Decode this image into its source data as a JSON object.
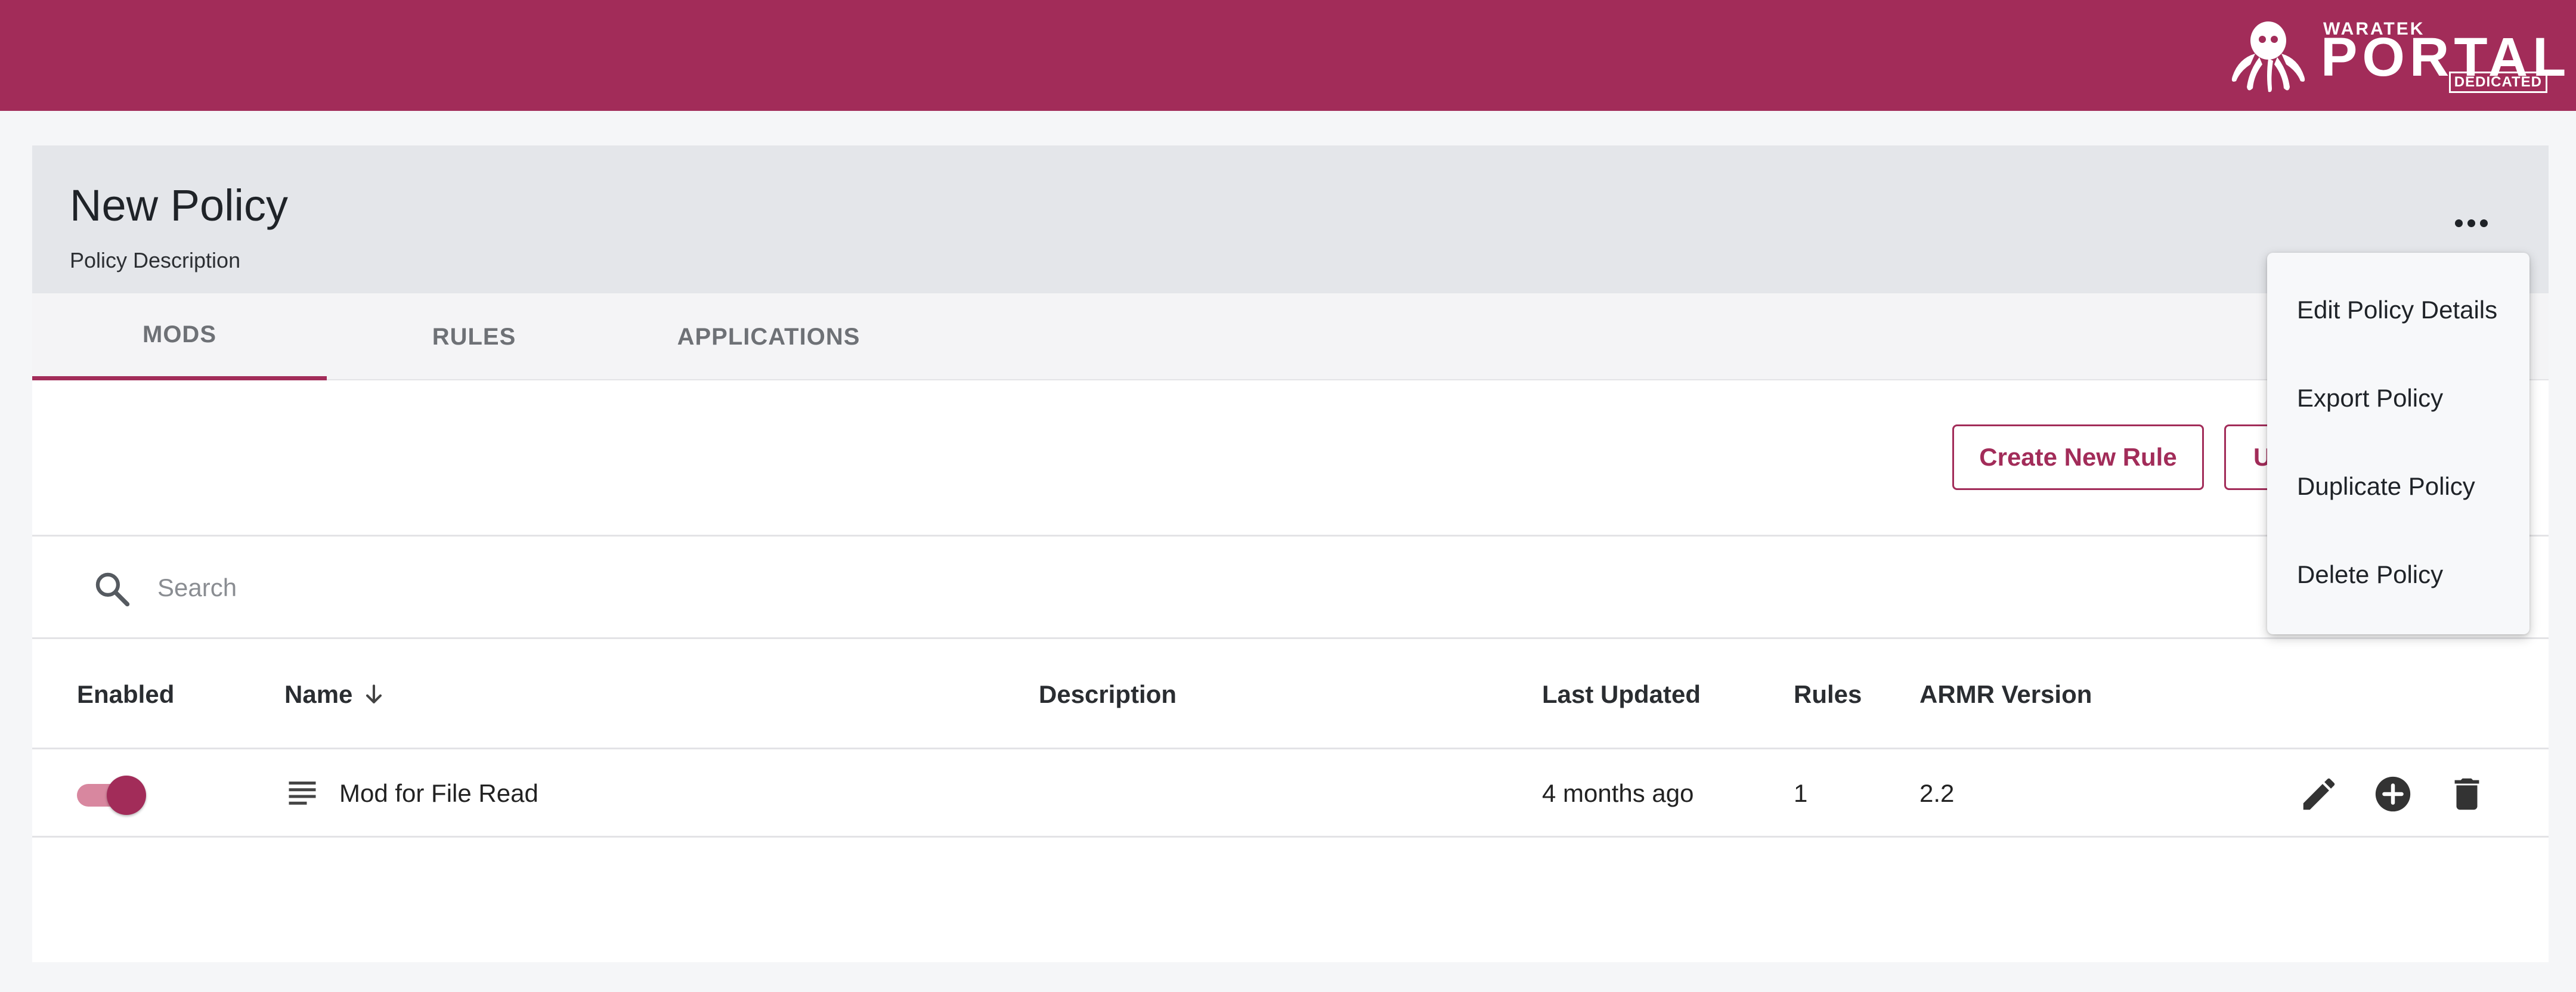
{
  "brand": {
    "small": "WARATEK",
    "big": "PORTAL",
    "badge": "DEDICATED",
    "primary_color": "#a22c59"
  },
  "policy": {
    "title": "New Policy",
    "description": "Policy Description"
  },
  "tabs": [
    {
      "label": "MODS",
      "active": true
    },
    {
      "label": "RULES",
      "active": false
    },
    {
      "label": "APPLICATIONS",
      "active": false
    }
  ],
  "toolbar": {
    "create_label": "Create New Rule",
    "second_label": "U"
  },
  "search": {
    "placeholder": "Search"
  },
  "table": {
    "columns": [
      "Enabled",
      "Name",
      "Description",
      "Last Updated",
      "Rules",
      "ARMR Version"
    ],
    "sort_column": "Name",
    "rows": [
      {
        "enabled": true,
        "name": "Mod for File Read",
        "description": "",
        "last_updated": "4 months ago",
        "rules": "1",
        "armr_version": "2.2"
      }
    ]
  },
  "menu": {
    "items": [
      "Edit Policy Details",
      "Export Policy",
      "Duplicate Policy",
      "Delete Policy"
    ]
  },
  "icons": {
    "more": "more-horizontal-icon",
    "search": "search-icon",
    "sort": "arrow-down-icon",
    "row": "notes-icon",
    "edit": "pencil-icon",
    "add": "add-circle-icon",
    "delete": "trash-icon"
  }
}
